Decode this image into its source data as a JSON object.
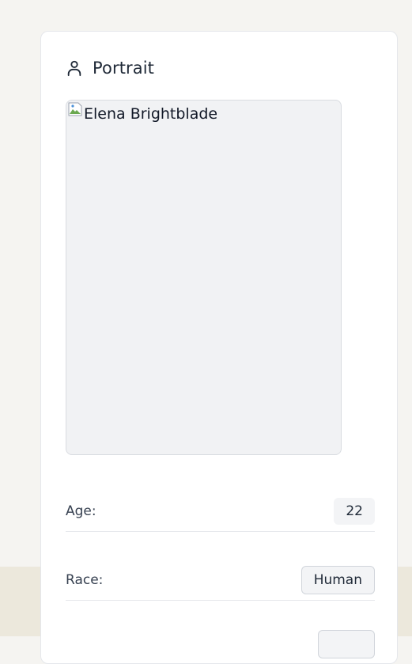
{
  "portrait_card": {
    "title": "Portrait",
    "icon": "user-icon",
    "image_alt": "Elena Brightblade"
  },
  "stats": {
    "age_label": "Age:",
    "age_value": "22",
    "race_label": "Race:",
    "race_value": "Human"
  },
  "colors": {
    "page_background": "#f5f4f1",
    "bottom_band": "#ece8dc",
    "card_background": "#ffffff",
    "portrait_placeholder": "#f1f2f4",
    "value_chip": "#f3f4f6"
  }
}
